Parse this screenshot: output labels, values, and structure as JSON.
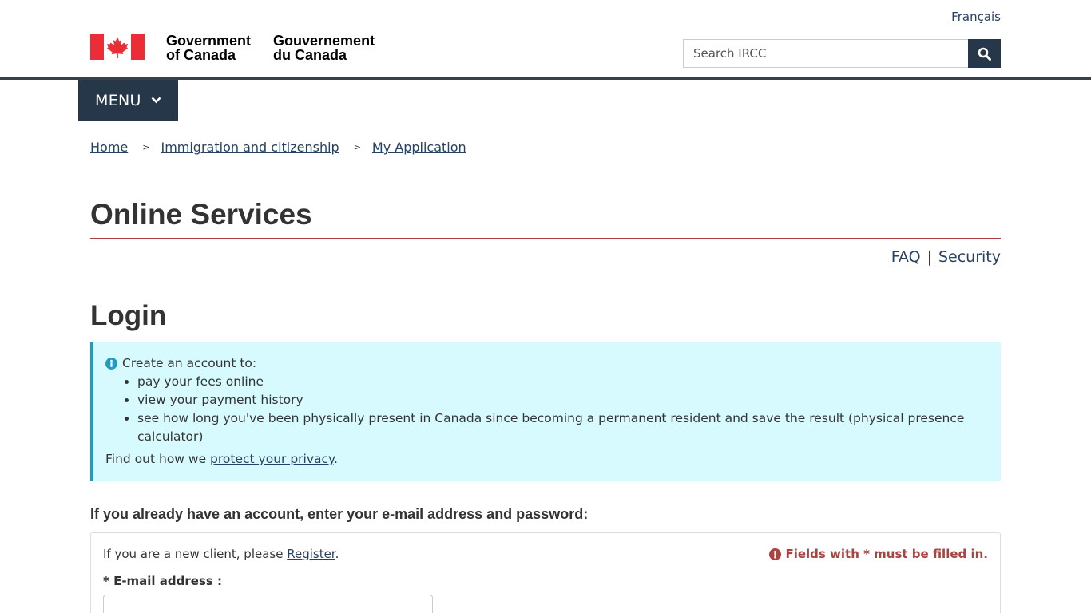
{
  "header": {
    "language_link": "Français",
    "signature_en_line1": "Government",
    "signature_en_line2": "of Canada",
    "signature_fr_line1": "Gouvernement",
    "signature_fr_line2": "du Canada",
    "search_placeholder": "Search IRCC",
    "search_icon": "search-icon",
    "flag_color": "#eb2d37"
  },
  "menu": {
    "label": "MENU",
    "icon": "chevron-down-icon",
    "color": "#26374a"
  },
  "breadcrumb": {
    "items": [
      "Home",
      "Immigration and citizenship",
      "My Application"
    ],
    "separator": ">"
  },
  "page": {
    "title": "Online Services",
    "faq_link": "FAQ",
    "pipe": "|",
    "security_link": "Security",
    "login_heading": "Login"
  },
  "info_alert": {
    "icon": "info-circle-icon",
    "heading": "Create an account to:",
    "items": [
      "pay your fees online",
      "view your payment history",
      "see how long you've been physically present in Canada since becoming a permanent resident and save the result (physical presence calculator)"
    ],
    "privacy_prefix": "Find out how we ",
    "privacy_link": "protect your privacy",
    "privacy_suffix": ".",
    "background": "#d7faff",
    "accent": "#269abc"
  },
  "login_form": {
    "intro": "If you already have an account, enter your e-mail address and password:",
    "new_client_prefix": "If you are a new client, please ",
    "register_link": "Register",
    "new_client_suffix": ".",
    "required_note": "Fields with * must be filled in.",
    "required_icon": "exclamation-circle-icon",
    "required_color": "#a94442",
    "email_label": "* E-mail address :",
    "email_value": ""
  }
}
